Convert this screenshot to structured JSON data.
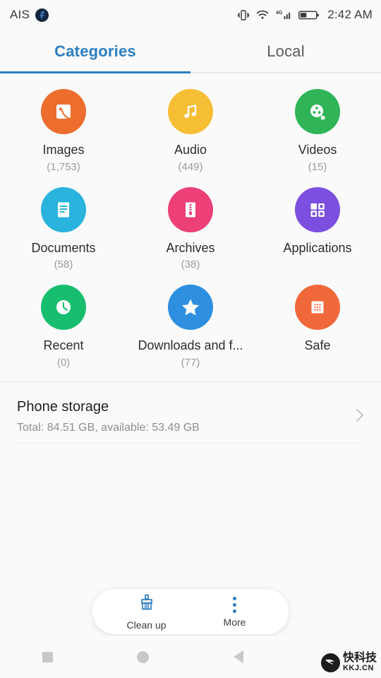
{
  "status_bar": {
    "carrier": "AIS",
    "badge_icon": "facebook-badge-icon",
    "icons": [
      "vibrate-icon",
      "wifi-icon",
      "signal-4g-icon",
      "battery-icon"
    ],
    "signal_label": "4G",
    "time": "2:42 AM"
  },
  "tabs": [
    {
      "label": "Categories",
      "active": true
    },
    {
      "label": "Local",
      "active": false
    }
  ],
  "categories": [
    {
      "label": "Images",
      "count": "(1,753)",
      "color": "#ED6D2E",
      "icon": "image-icon"
    },
    {
      "label": "Audio",
      "count": "(449)",
      "color": "#F6BE34",
      "icon": "music-note-icon"
    },
    {
      "label": "Videos",
      "count": "(15)",
      "color": "#2FB457",
      "icon": "film-reel-icon"
    },
    {
      "label": "Documents",
      "count": "(58)",
      "color": "#2AB3DC",
      "icon": "document-icon"
    },
    {
      "label": "Archives",
      "count": "(38)",
      "color": "#EC4077",
      "icon": "archive-zip-icon"
    },
    {
      "label": "Applications",
      "count": "",
      "color": "#7C4FE0",
      "icon": "apps-grid-icon"
    },
    {
      "label": "Recent",
      "count": "(0)",
      "color": "#18BE70",
      "icon": "clock-icon"
    },
    {
      "label": "Downloads and f...",
      "count": "(77)",
      "color": "#2E8EE0",
      "icon": "star-icon"
    },
    {
      "label": "Safe",
      "count": "",
      "color": "#F0683A",
      "icon": "safe-keypad-icon"
    }
  ],
  "storage": {
    "title": "Phone storage",
    "subtitle": "Total: 84.51 GB, available: 53.49 GB",
    "chevron_icon": "chevron-right-icon"
  },
  "bottom_bar": {
    "clean_up": {
      "label": "Clean up",
      "icon": "broom-icon"
    },
    "more": {
      "label": "More",
      "icon": "more-vertical-icon"
    }
  },
  "nav_bar": {
    "recents_icon": "square-recents-icon",
    "home_icon": "circle-home-icon",
    "back_icon": "triangle-back-icon"
  },
  "watermark": {
    "cn": "快科技",
    "en": "KKJ.CN",
    "logo_icon": "kkj-logo-icon"
  },
  "colors": {
    "accent": "#2b7ec1",
    "background": "#fafafa"
  }
}
